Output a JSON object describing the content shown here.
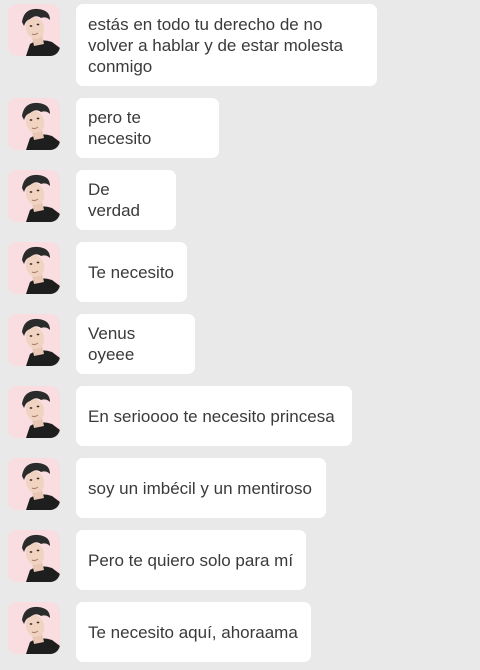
{
  "colors": {
    "background": "#e9e9e9",
    "bubble": "#ffffff",
    "avatar_bg": "#f9dde1",
    "text": "#3a3a3a"
  },
  "avatar": {
    "icon": "user-avatar-icon"
  },
  "messages": [
    {
      "text": "estás en todo tu derecho de no volver a hablar y de estar molesta conmigo"
    },
    {
      "text": "pero te necesito"
    },
    {
      "text": "De verdad"
    },
    {
      "text": "Te necesito"
    },
    {
      "text": "Venus oyeee"
    },
    {
      "text": "En serioooo te necesito princesa"
    },
    {
      "text": "soy un imbécil y un mentiroso"
    },
    {
      "text": "Pero te quiero solo para mí"
    },
    {
      "text": "Te necesito aquí, ahoraama"
    }
  ]
}
